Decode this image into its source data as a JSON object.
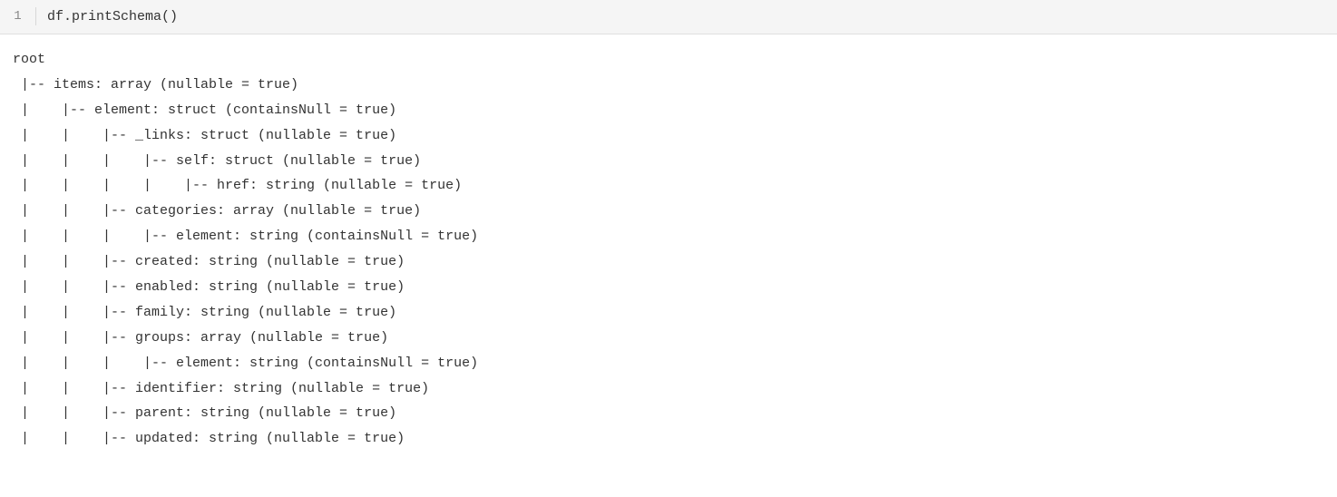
{
  "code_cell": {
    "line_number": "1",
    "code": "df.printSchema()"
  },
  "output": {
    "root_label": "root",
    "lines": [
      " |-- items: array (nullable = true)",
      " |    |-- element: struct (containsNull = true)",
      " |    |    |-- _links: struct (nullable = true)",
      " |    |    |    |-- self: struct (nullable = true)",
      " |    |    |    |    |-- href: string (nullable = true)",
      " |    |    |-- categories: array (nullable = true)",
      " |    |    |    |-- element: string (containsNull = true)",
      " |    |    |-- created: string (nullable = true)",
      " |    |    |-- enabled: string (nullable = true)",
      " |    |    |-- family: string (nullable = true)",
      " |    |    |-- groups: array (nullable = true)",
      " |    |    |    |-- element: string (containsNull = true)",
      " |    |    |-- identifier: string (nullable = true)",
      " |    |    |-- parent: string (nullable = true)",
      " |    |    |-- updated: string (nullable = true)"
    ]
  }
}
